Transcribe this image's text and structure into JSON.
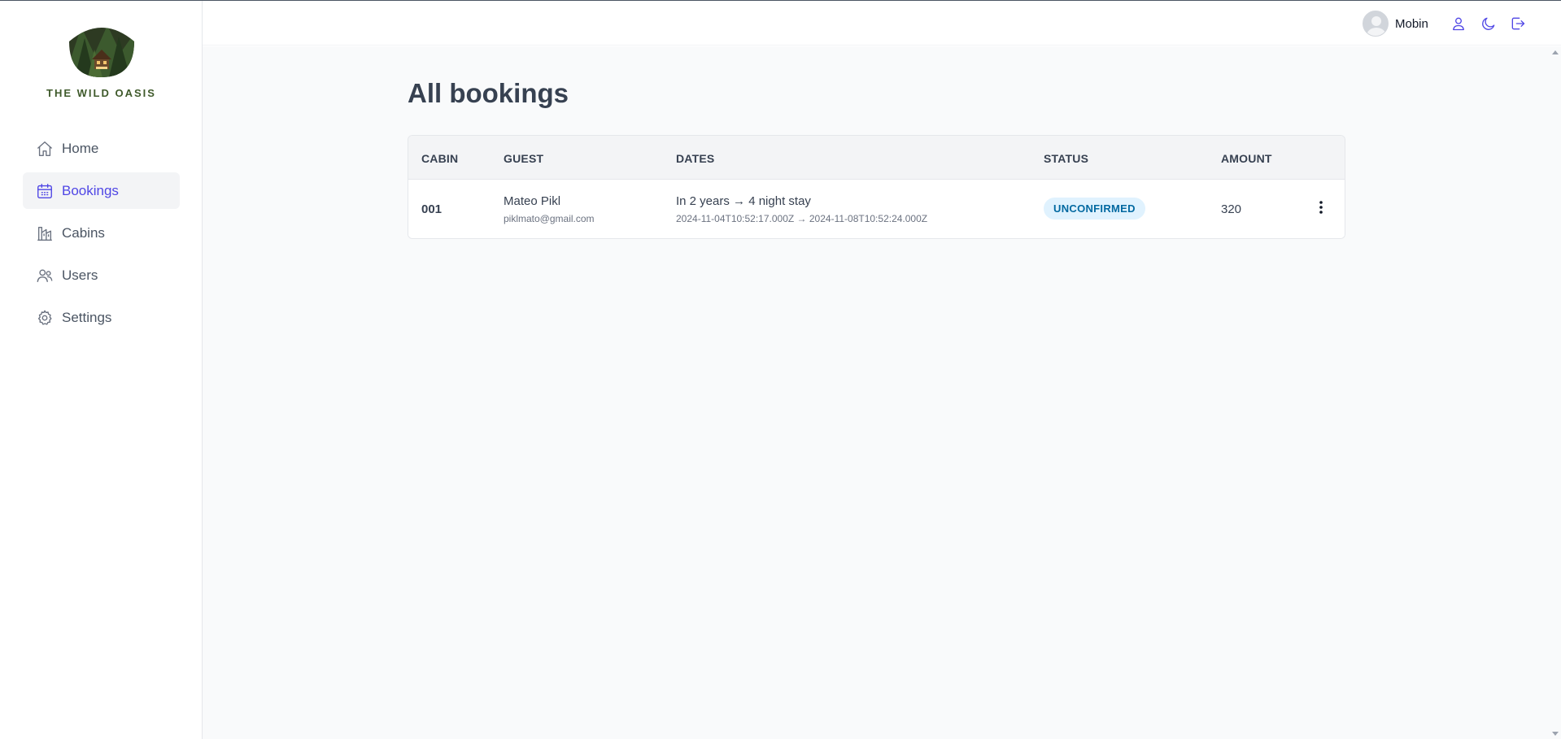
{
  "brand": {
    "name": "THE WILD OASIS"
  },
  "sidebar": {
    "items": [
      {
        "label": "Home",
        "icon": "home-icon",
        "active": false
      },
      {
        "label": "Bookings",
        "icon": "calendar-icon",
        "active": true
      },
      {
        "label": "Cabins",
        "icon": "cabins-icon",
        "active": false
      },
      {
        "label": "Users",
        "icon": "users-icon",
        "active": false
      },
      {
        "label": "Settings",
        "icon": "settings-icon",
        "active": false
      }
    ]
  },
  "header": {
    "username": "Mobin",
    "buttons": [
      "user-icon",
      "moon-icon",
      "logout-icon"
    ]
  },
  "main": {
    "title": "All bookings",
    "table": {
      "columns": [
        "CABIN",
        "GUEST",
        "DATES",
        "STATUS",
        "AMOUNT"
      ],
      "rows": [
        {
          "cabin": "001",
          "guest_name": "Mateo Pikl",
          "guest_email": "piklmato@gmail.com",
          "dates_summary": "In 2 years → 4 night stay",
          "dates_range": "2024-11-04T10:52:17.000Z → 2024-11-08T10:52:24.000Z",
          "status": "UNCONFIRMED",
          "amount": "320"
        }
      ]
    }
  },
  "colors": {
    "accent": "#4f46e5",
    "status_unconfirmed_bg": "#e0f2fe",
    "status_unconfirmed_text": "#0369a1"
  }
}
